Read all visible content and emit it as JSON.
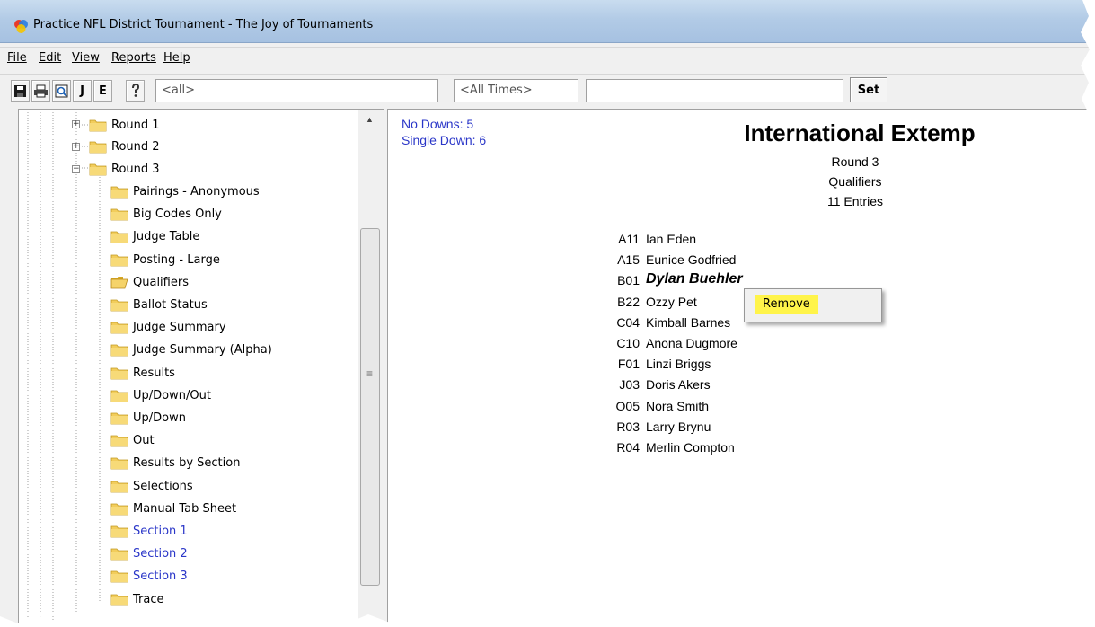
{
  "window": {
    "title": "Practice NFL District Tournament - The Joy of Tournaments"
  },
  "menu": [
    "File",
    "Edit",
    "View",
    "Reports",
    "Help"
  ],
  "toolbar": {
    "j_label": "J",
    "e_label": "E",
    "filter_value": "<all>",
    "time_value": "<All Times>",
    "text_value": "",
    "set_label": "Set"
  },
  "tree": {
    "rounds": [
      {
        "label": "Round 1",
        "expanded": false
      },
      {
        "label": "Round 2",
        "expanded": false
      },
      {
        "label": "Round 3",
        "expanded": true
      }
    ],
    "round3_children": [
      {
        "label": "Pairings - Anonymous",
        "blue": false
      },
      {
        "label": "Big Codes Only",
        "blue": false
      },
      {
        "label": "Judge Table",
        "blue": false
      },
      {
        "label": "Posting - Large",
        "blue": false
      },
      {
        "label": "Qualifiers",
        "blue": false,
        "open": true
      },
      {
        "label": "Ballot Status",
        "blue": false
      },
      {
        "label": "Judge Summary",
        "blue": false
      },
      {
        "label": "Judge Summary (Alpha)",
        "blue": false
      },
      {
        "label": "Results",
        "blue": false
      },
      {
        "label": "Up/Down/Out",
        "blue": false
      },
      {
        "label": "Up/Down",
        "blue": false
      },
      {
        "label": "Out",
        "blue": false
      },
      {
        "label": "Results by Section",
        "blue": false
      },
      {
        "label": "Selections",
        "blue": false
      },
      {
        "label": "Manual Tab Sheet",
        "blue": false
      },
      {
        "label": "Section 1",
        "blue": true
      },
      {
        "label": "Section 2",
        "blue": true
      },
      {
        "label": "Section 3",
        "blue": true
      },
      {
        "label": "Trace",
        "blue": false
      }
    ]
  },
  "report": {
    "no_downs": "No Downs: 5",
    "single_down": "Single Down: 6",
    "title": "International Extemp",
    "round": "Round 3",
    "subtitle": "Qualifiers",
    "entries_count": "11 Entries",
    "entries": [
      {
        "code": "A11",
        "name": "Ian Eden",
        "italic": false
      },
      {
        "code": "A15",
        "name": "Eunice Godfried",
        "italic": false
      },
      {
        "code": "B01",
        "name": "Dylan Buehler",
        "italic": true
      },
      {
        "code": "B22",
        "name": "Ozzy Pet",
        "italic": false
      },
      {
        "code": "C04",
        "name": "Kimball Barnes",
        "italic": false
      },
      {
        "code": "C10",
        "name": "Anona Dugmore",
        "italic": false
      },
      {
        "code": "F01",
        "name": "Linzi Briggs",
        "italic": false
      },
      {
        "code": "J03",
        "name": "Doris Akers",
        "italic": false
      },
      {
        "code": "O05",
        "name": "Nora Smith",
        "italic": false
      },
      {
        "code": "R03",
        "name": "Larry Brynu",
        "italic": false
      },
      {
        "code": "R04",
        "name": "Merlin Compton",
        "italic": false
      }
    ]
  },
  "context_menu": {
    "remove_label": "Remove"
  },
  "colors": {
    "blue_text": "#2a36c8",
    "highlight": "#fff44a"
  }
}
